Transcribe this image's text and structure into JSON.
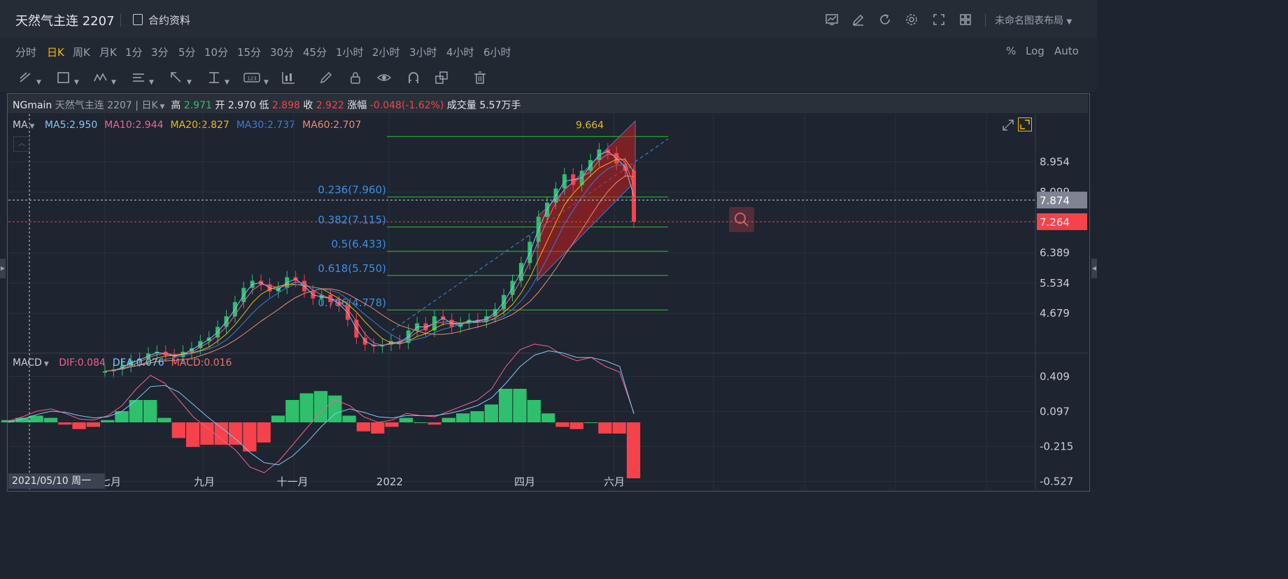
{
  "header": {
    "title": "天然气主连 2207",
    "contract_label": "合约资料",
    "layout_label": "未命名图表布局",
    "toolbar_icons": [
      "chart-icon",
      "edit-icon",
      "refresh-icon",
      "gear-icon",
      "fullscreen-icon",
      "grid-icon"
    ]
  },
  "periods": {
    "items": [
      "分时",
      "日K",
      "周K",
      "月K",
      "1分",
      "3分",
      "5分",
      "10分",
      "15分",
      "30分",
      "45分",
      "1小时",
      "2小时",
      "3小时",
      "4小时",
      "6小时"
    ],
    "active": "日K",
    "right_options": [
      "%",
      "Log",
      "Auto"
    ]
  },
  "drawing_tools": [
    "trendline-tool-icon",
    "rectangle-tool-icon",
    "pattern-tool-icon",
    "text-tool-icon",
    "arrow-tool-icon",
    "fib-tool-icon",
    "number-tool-icon",
    "candle-tool-icon",
    "pen-icon",
    "lock-icon",
    "eye-icon",
    "magnet-icon",
    "layers-icon",
    "trash-icon"
  ],
  "info": {
    "symbol": "NGmain",
    "name": "天然气主连 2207",
    "period": "日K",
    "high_label": "高",
    "high": "2.971",
    "open_label": "开",
    "open": "2.970",
    "low_label": "低",
    "low": "2.898",
    "close_label": "收",
    "close": "2.922",
    "change_label": "涨幅",
    "change": "-0.048(-1.62%)",
    "volume_label": "成交量",
    "volume": "5.57万手"
  },
  "ma_legend": {
    "label": "MA",
    "items": [
      {
        "text": "MA5:2.950",
        "color": "#7fc8f8"
      },
      {
        "text": "MA10:2.944",
        "color": "#f06292"
      },
      {
        "text": "MA20:2.827",
        "color": "#f0b90b"
      },
      {
        "text": "MA30:2.737",
        "color": "#3b7dd8"
      },
      {
        "text": "MA60:2.707",
        "color": "#ef8a6f"
      }
    ]
  },
  "macd_legend": {
    "label": "MACD",
    "items": [
      {
        "text": "DIF:0.084",
        "color": "#f06292"
      },
      {
        "text": "DEA:0.076",
        "color": "#7fc8f8"
      },
      {
        "text": "MACD:0.016",
        "color": "#ef6f6f"
      }
    ]
  },
  "crosshair_date": "2021/05/10 周一",
  "colors": {
    "up": "#2ec06c",
    "down": "#f5424b",
    "fib": "#2fc23a",
    "fib_text": "#3d8fe0",
    "accent": "#f0b90b"
  },
  "chart_data": [
    {
      "type": "candlestick",
      "title": "天然气主连 2207 日K",
      "y_axis_ticks": [
        8.954,
        8.099,
        6.389,
        5.534,
        4.679
      ],
      "ylim": [
        3.6,
        10.3
      ],
      "price_labels": [
        {
          "value": "7.874",
          "kind": "crosshair"
        },
        {
          "value": "7.264",
          "kind": "last"
        }
      ],
      "x_axis_ticks": [
        "七月",
        "九月",
        "十一月",
        "2022",
        "四月",
        "六月"
      ],
      "fibonacci": [
        {
          "label": "0.236(7.960)",
          "value": 7.96
        },
        {
          "label": "0.382(7.115)",
          "value": 7.115
        },
        {
          "label": "0.5(6.433)",
          "value": 6.433
        },
        {
          "label": "0.618(5.750)",
          "value": 5.75
        },
        {
          "label": "0.786(4.778)",
          "value": 4.778
        }
      ],
      "fib_top_label": "9.664",
      "close_path": [
        3.05,
        3.1,
        3.2,
        3.35,
        3.4,
        3.55,
        3.6,
        3.5,
        3.45,
        3.6,
        3.7,
        3.9,
        4.0,
        4.3,
        4.6,
        5.0,
        5.4,
        5.6,
        5.5,
        5.3,
        5.4,
        5.7,
        5.6,
        5.3,
        5.1,
        5.2,
        5.0,
        4.9,
        4.5,
        4.0,
        3.8,
        3.75,
        3.8,
        3.9,
        3.85,
        4.2,
        4.4,
        4.2,
        4.6,
        4.5,
        4.3,
        4.4,
        4.5,
        4.45,
        4.6,
        4.8,
        5.2,
        5.6,
        6.1,
        6.7,
        7.4,
        7.8,
        8.2,
        8.6,
        8.3,
        8.7,
        9.0,
        9.3,
        9.2,
        8.9,
        8.7,
        7.264
      ]
    },
    {
      "type": "macd",
      "y_axis_ticks": [
        0.409,
        0.097,
        -0.215,
        -0.527
      ],
      "ylim": [
        -0.6,
        0.6
      ],
      "dif": [
        0.01,
        0.05,
        0.1,
        0.12,
        0.08,
        0.03,
        0.02,
        0.06,
        0.15,
        0.3,
        0.42,
        0.35,
        0.2,
        0.05,
        -0.05,
        -0.15,
        -0.25,
        -0.4,
        -0.45,
        -0.35,
        -0.2,
        -0.05,
        0.1,
        0.2,
        0.15,
        0.05,
        0.0,
        0.02,
        0.08,
        0.06,
        0.05,
        0.1,
        0.15,
        0.2,
        0.3,
        0.5,
        0.65,
        0.7,
        0.68,
        0.6,
        0.55,
        0.58,
        0.5,
        0.45,
        0.084
      ],
      "dea": [
        0.0,
        0.03,
        0.07,
        0.1,
        0.09,
        0.06,
        0.04,
        0.05,
        0.1,
        0.2,
        0.32,
        0.33,
        0.27,
        0.16,
        0.05,
        -0.05,
        -0.15,
        -0.27,
        -0.36,
        -0.38,
        -0.3,
        -0.18,
        -0.04,
        0.08,
        0.12,
        0.09,
        0.05,
        0.04,
        0.06,
        0.06,
        0.06,
        0.08,
        0.11,
        0.15,
        0.22,
        0.35,
        0.5,
        0.6,
        0.64,
        0.62,
        0.58,
        0.58,
        0.55,
        0.5,
        0.076
      ],
      "macd": [
        0.02,
        0.04,
        0.06,
        0.04,
        -0.02,
        -0.06,
        -0.04,
        0.02,
        0.1,
        0.2,
        0.2,
        0.04,
        -0.14,
        -0.22,
        -0.2,
        -0.2,
        -0.2,
        -0.26,
        -0.18,
        0.06,
        0.2,
        0.26,
        0.28,
        0.24,
        0.06,
        -0.08,
        -0.1,
        -0.04,
        0.04,
        0.0,
        -0.02,
        0.04,
        0.08,
        0.1,
        0.16,
        0.3,
        0.3,
        0.2,
        0.08,
        -0.04,
        -0.06,
        0.0,
        -0.1,
        -0.1,
        -0.5
      ]
    }
  ]
}
